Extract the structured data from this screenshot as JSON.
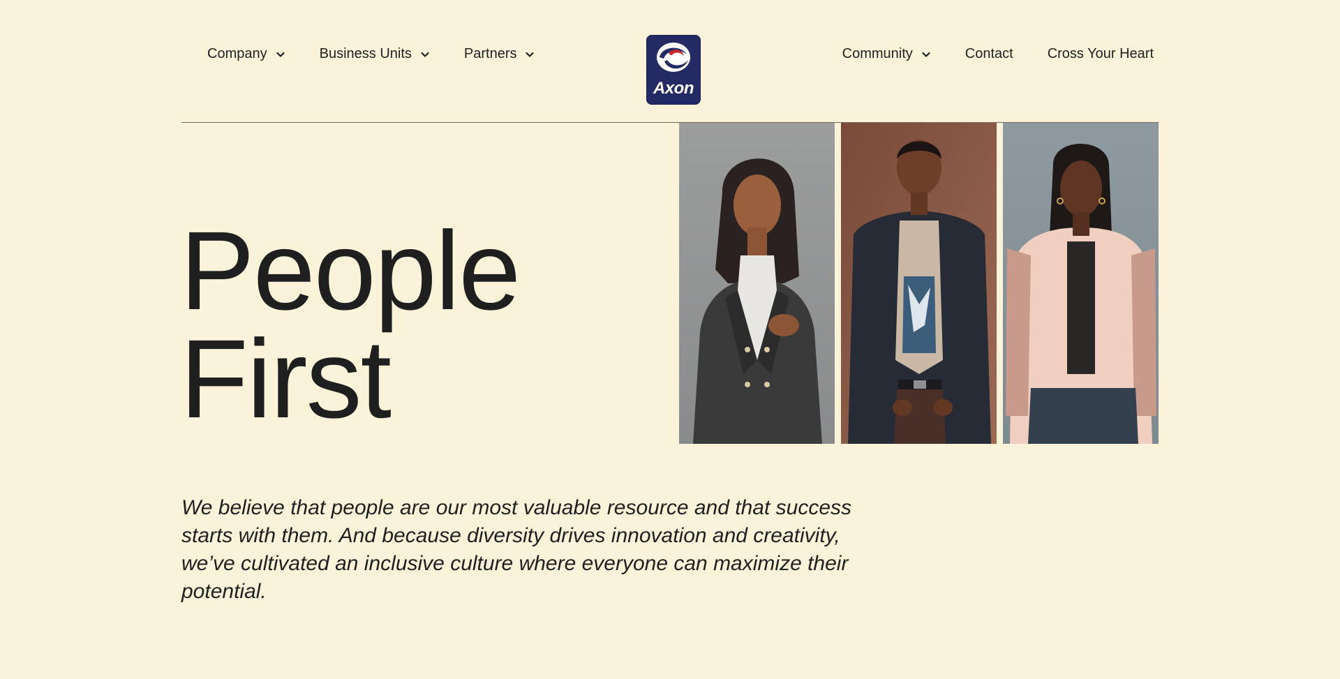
{
  "nav": {
    "left_items": [
      {
        "label": "Company",
        "has_dropdown": true
      },
      {
        "label": "Business Units",
        "has_dropdown": true
      },
      {
        "label": "Partners",
        "has_dropdown": true
      }
    ],
    "right_items": [
      {
        "label": "Community",
        "has_dropdown": true
      },
      {
        "label": "Contact",
        "has_dropdown": false
      },
      {
        "label": "Cross Your Heart",
        "has_dropdown": false
      }
    ],
    "logo": {
      "text": "Axon"
    }
  },
  "hero": {
    "title_line1": "People",
    "title_line2": "First",
    "photos": [
      {
        "description": "woman-in-dark-blazer"
      },
      {
        "description": "man-in-dark-suit"
      },
      {
        "description": "woman-in-pink-blazer"
      }
    ]
  },
  "statement": {
    "text": "We believe that people are our most valuable resource and that success starts with them. And because diversity drives innovation and creativity, we’ve cultivated an inclusive culture where everyone can maximize their potential."
  },
  "colors": {
    "background": "#fbf3d9",
    "text": "#1f1f1f",
    "logo_bg": "#242a63",
    "logo_accent": "#c8282d"
  },
  "icons": [
    "chevron-down-icon",
    "axon-logo"
  ]
}
